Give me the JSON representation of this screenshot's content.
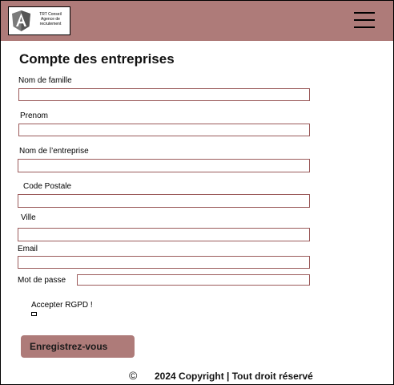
{
  "header": {
    "logo_lines": [
      "TRT Conseil",
      "Agence de",
      "recrutement"
    ],
    "logo_icon": "angular-shield-icon",
    "menu_icon": "hamburger-menu-icon",
    "color": "#ae7b79"
  },
  "form": {
    "title": "Compte des entreprises",
    "fields": {
      "nom": {
        "label": "Nom de famille",
        "value": ""
      },
      "prenom": {
        "label": "Prenom",
        "value": ""
      },
      "entreprise": {
        "label": "Nom de l’entreprise",
        "value": ""
      },
      "code_postale": {
        "label": "Code Postale",
        "value": ""
      },
      "ville": {
        "label": "Ville",
        "value": ""
      },
      "email": {
        "label": "Email",
        "value": ""
      },
      "password": {
        "label": "Mot de passe",
        "value": ""
      }
    },
    "rgpd_label": "Accepter RGPD !",
    "submit_label": "Enregistrez-vous"
  },
  "footer": {
    "copyright_symbol": "©",
    "text": "2024 Copyright | Tout droit réservé"
  }
}
